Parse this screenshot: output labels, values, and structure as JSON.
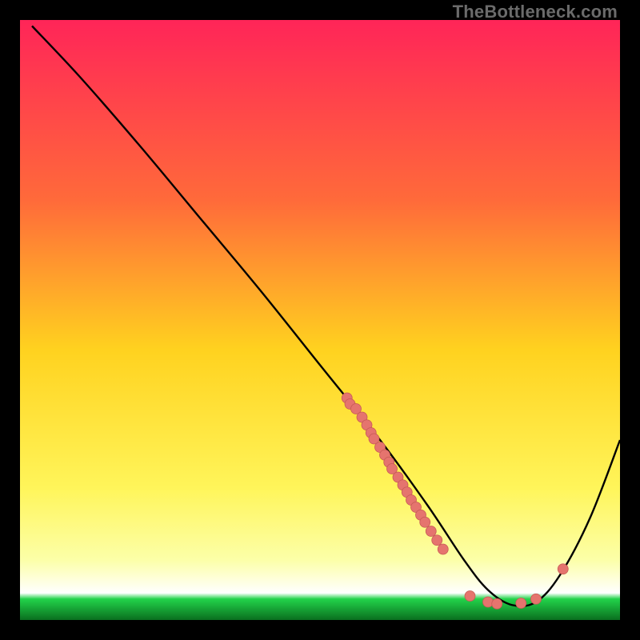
{
  "watermark": "TheBottleneck.com",
  "colors": {
    "curve": "#000000",
    "point_fill": "#e5746e",
    "point_stroke": "#c75a55",
    "green_band": "#22d34a"
  },
  "chart_data": {
    "type": "line",
    "title": "",
    "xlabel": "",
    "ylabel": "",
    "xlim": [
      0,
      100
    ],
    "ylim": [
      0,
      100
    ],
    "gradient_stops": [
      {
        "offset": 0,
        "color": "#ff2558"
      },
      {
        "offset": 0.3,
        "color": "#ff6a3a"
      },
      {
        "offset": 0.55,
        "color": "#ffd21f"
      },
      {
        "offset": 0.78,
        "color": "#fff55a"
      },
      {
        "offset": 0.9,
        "color": "#fcffa8"
      },
      {
        "offset": 0.955,
        "color": "#ffffff"
      },
      {
        "offset": 0.965,
        "color": "#22d34a"
      },
      {
        "offset": 1.0,
        "color": "#0a6f1f"
      }
    ],
    "series": [
      {
        "name": "bottleneck-curve",
        "x": [
          2,
          10,
          20,
          30,
          40,
          50,
          60,
          68,
          74,
          78,
          82,
          86,
          90,
          95,
          100
        ],
        "y": [
          99,
          90.5,
          79,
          67,
          55,
          42.5,
          30,
          19,
          10,
          5,
          2.5,
          3,
          7.5,
          17,
          30
        ]
      }
    ],
    "scatter": {
      "name": "data-points",
      "points": [
        {
          "x": 54.5,
          "y": 37.0
        },
        {
          "x": 55.0,
          "y": 36.0
        },
        {
          "x": 56.0,
          "y": 35.2
        },
        {
          "x": 57.0,
          "y": 33.8
        },
        {
          "x": 57.8,
          "y": 32.5
        },
        {
          "x": 58.5,
          "y": 31.2
        },
        {
          "x": 59.0,
          "y": 30.2
        },
        {
          "x": 60.0,
          "y": 28.8
        },
        {
          "x": 60.8,
          "y": 27.5
        },
        {
          "x": 61.5,
          "y": 26.3
        },
        {
          "x": 62.0,
          "y": 25.2
        },
        {
          "x": 63.0,
          "y": 23.8
        },
        {
          "x": 63.8,
          "y": 22.5
        },
        {
          "x": 64.5,
          "y": 21.3
        },
        {
          "x": 65.2,
          "y": 20.0
        },
        {
          "x": 66.0,
          "y": 18.8
        },
        {
          "x": 66.8,
          "y": 17.5
        },
        {
          "x": 67.5,
          "y": 16.3
        },
        {
          "x": 68.5,
          "y": 14.8
        },
        {
          "x": 69.5,
          "y": 13.3
        },
        {
          "x": 70.5,
          "y": 11.8
        },
        {
          "x": 75.0,
          "y": 4.0
        },
        {
          "x": 78.0,
          "y": 3.0
        },
        {
          "x": 79.5,
          "y": 2.7
        },
        {
          "x": 83.5,
          "y": 2.8
        },
        {
          "x": 86.0,
          "y": 3.5
        },
        {
          "x": 90.5,
          "y": 8.5
        }
      ]
    }
  }
}
